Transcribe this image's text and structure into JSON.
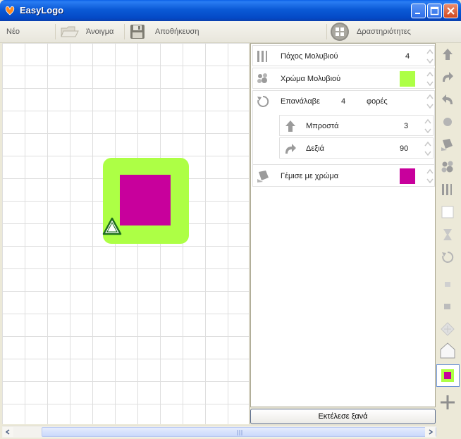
{
  "window": {
    "title": "EasyLogo"
  },
  "toolbar": {
    "new_label": "Νέο",
    "open_label": "Άνοιγμα",
    "save_label": "Αποθήκευση",
    "activities_label": "Δραστηριότητες"
  },
  "canvas": {
    "outer_square_color": "#adff45",
    "inner_square_color": "#c8009c",
    "turtle_color": "#1e6e1e"
  },
  "commands": [
    {
      "label": "Πάχος Μολυβιού",
      "value": "4",
      "icon": "pen-width-icon"
    },
    {
      "label": "Χρώμα Μολυβιού",
      "color": "#adff45",
      "icon": "palette-icon"
    },
    {
      "label": "Επανάλαβε",
      "value": "4",
      "suffix": "φορές",
      "icon": "repeat-icon"
    },
    {
      "label": "Μπροστά",
      "value": "3",
      "icon": "forward-arrow-icon"
    },
    {
      "label": "Δεξιά",
      "value": "90",
      "icon": "turn-right-icon"
    },
    {
      "label": "Γέμισε με χρώμα",
      "color": "#c8009c",
      "icon": "fill-bucket-icon"
    }
  ],
  "run_button_label": "Εκτέλεσε ξανά",
  "right_toolbar": [
    "forward-icon",
    "turn-right-icon",
    "turn-left-icon",
    "pen-icon",
    "fill-icon",
    "palette-icon",
    "pen-width-icon",
    "clear-icon",
    "wait-icon",
    "repeat-icon",
    "small-square-icon",
    "square-icon",
    "diamond-icon",
    "house-icon",
    "colored-square-icon",
    "add-icon"
  ]
}
